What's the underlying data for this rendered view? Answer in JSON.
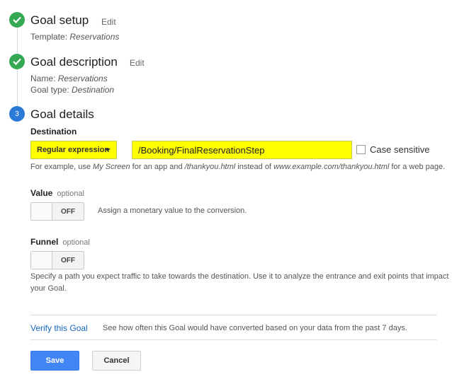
{
  "steps": [
    {
      "title": "Goal setup",
      "edit": "Edit",
      "lines": [
        {
          "label": "Template:",
          "value": "Reservations"
        }
      ]
    },
    {
      "title": "Goal description",
      "edit": "Edit",
      "lines": [
        {
          "label": "Name:",
          "value": "Reservations"
        },
        {
          "label": "Goal type:",
          "value": "Destination"
        }
      ]
    },
    {
      "title": "Goal details",
      "number": "3"
    }
  ],
  "destination": {
    "label": "Destination",
    "match_type": "Regular expression",
    "value": "/Booking/FinalReservationStep",
    "case_sensitive_label": "Case sensitive",
    "help": {
      "p1": "For example, use ",
      "e1": "My Screen",
      "p2": " for an app and ",
      "e2": "/thankyou.html",
      "p3": " instead of ",
      "e3": "www.example.com/thankyou.html",
      "p4": " for a web page."
    }
  },
  "value_section": {
    "label": "Value",
    "optional": "optional",
    "toggle_state": "OFF",
    "description": "Assign a monetary value to the conversion."
  },
  "funnel_section": {
    "label": "Funnel",
    "optional": "optional",
    "toggle_state": "OFF",
    "description_line1": "Specify a path you expect traffic to take towards the destination. Use it to analyze the entrance and exit points that impact",
    "description_line2": "your Goal."
  },
  "verify": {
    "link": "Verify this Goal",
    "text": "See how often this Goal would have converted based on your data from the past 7 days."
  },
  "buttons": {
    "save": "Save",
    "cancel": "Cancel"
  },
  "colors": {
    "done": "#34a853",
    "current": "#2b7bd6",
    "highlight": "#ffff00",
    "primary": "#4285f4",
    "link": "#1565c0"
  }
}
